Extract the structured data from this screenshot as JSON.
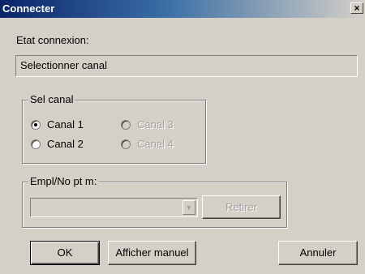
{
  "window": {
    "title": "Connecter",
    "close_label": "×"
  },
  "connection": {
    "label": "Etat connexion:",
    "value": "Selectionner canal"
  },
  "channel_group": {
    "legend": "Sel canal",
    "channels": [
      {
        "label": "Canal 1",
        "selected": true,
        "enabled": true
      },
      {
        "label": "Canal 2",
        "selected": false,
        "enabled": true
      },
      {
        "label": "Canal 3",
        "selected": false,
        "enabled": false
      },
      {
        "label": "Canal 4",
        "selected": false,
        "enabled": false
      }
    ]
  },
  "location_group": {
    "legend": "Empl/No pt m:",
    "combo_value": "",
    "remove_label": "Retirer"
  },
  "buttons": {
    "ok": "OK",
    "manual": "Afficher manuel",
    "cancel": "Annuler"
  },
  "icons": {
    "close": "close-icon",
    "dropdown": "chevron-down-icon"
  }
}
